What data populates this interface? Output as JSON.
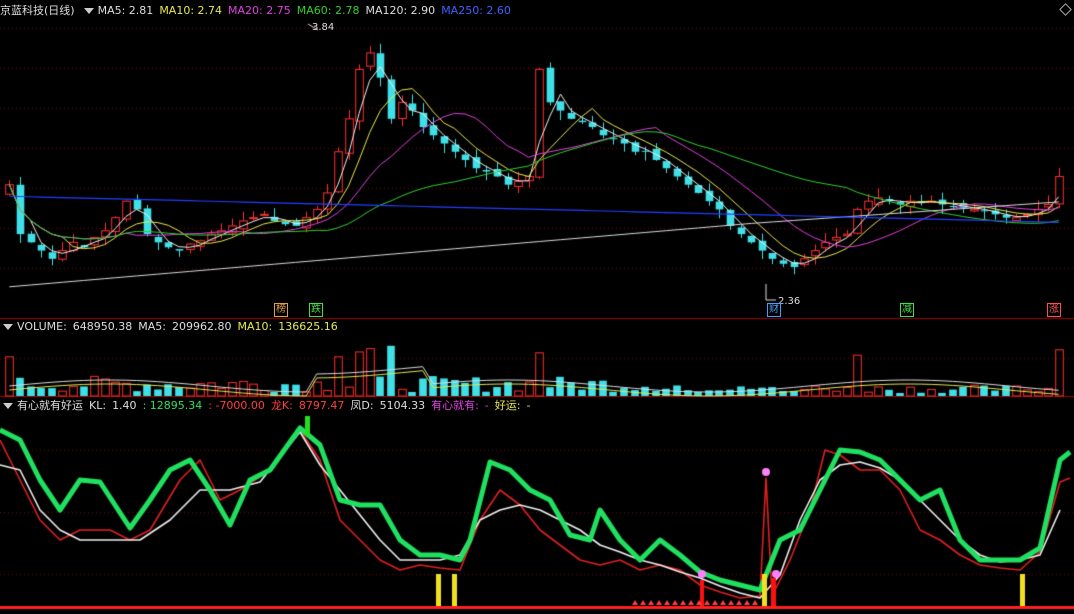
{
  "price_panel": {
    "title": "京蓝科技(日线)",
    "indicators": [
      {
        "name": "MA5",
        "value": "2.81",
        "color": "#dddddd"
      },
      {
        "name": "MA10",
        "value": "2.74",
        "color": "#e8e850"
      },
      {
        "name": "MA20",
        "value": "2.75",
        "color": "#e040e0"
      },
      {
        "name": "MA60",
        "value": "2.78",
        "color": "#30d030"
      },
      {
        "name": "MA120",
        "value": "2.90",
        "color": "#dddddd"
      },
      {
        "name": "MA250",
        "value": "2.60",
        "color": "#4060ff"
      }
    ],
    "high_label": "3.84",
    "low_label": "2.36",
    "event_tags": [
      {
        "text": "榜",
        "color": "#e0a040"
      },
      {
        "text": "跌",
        "color": "#40e040"
      },
      {
        "text": "财",
        "color": "#40a0ff"
      },
      {
        "text": "减",
        "color": "#40e040"
      },
      {
        "text": "涨",
        "color": "#ff5050"
      }
    ]
  },
  "volume_panel": {
    "label": "VOLUME",
    "value": "648950.38",
    "ma5_label": "MA5",
    "ma5_value": "209962.80",
    "ma10_label": "MA10",
    "ma10_value": "136625.16"
  },
  "indicator_panel": {
    "name": "有心就有好运",
    "kl_label": "KL",
    "kl_value": "1.40",
    "v1": "12895.34",
    "v2": "-7000.00",
    "k_label": "龙K",
    "k_value": "8797.47",
    "d_label": "凤D",
    "d_value": "5104.33",
    "t1": "有心就有",
    "t1_value": "-",
    "t2": "好运",
    "t2_value": "-"
  },
  "colors": {
    "up": "#ff3030",
    "down": "#40e0e8",
    "ma250": "#2040ff",
    "green": "#20e060"
  },
  "chart_data": {
    "type": "candlestick",
    "price_range": [
      2.2,
      3.9
    ],
    "candles_close": [
      2.9,
      2.6,
      2.55,
      2.5,
      2.45,
      2.5,
      2.55,
      2.52,
      2.58,
      2.62,
      2.7,
      2.8,
      2.75,
      2.6,
      2.55,
      2.52,
      2.5,
      2.54,
      2.56,
      2.6,
      2.62,
      2.65,
      2.68,
      2.7,
      2.72,
      2.68,
      2.66,
      2.65,
      2.7,
      2.75,
      2.85,
      3.1,
      3.3,
      3.6,
      3.7,
      3.55,
      3.3,
      3.4,
      3.35,
      3.25,
      3.2,
      3.15,
      3.1,
      3.05,
      3.0,
      2.98,
      2.95,
      2.9,
      2.92,
      2.95,
      3.6,
      3.4,
      3.35,
      3.3,
      3.28,
      3.25,
      3.2,
      3.18,
      3.15,
      3.1,
      3.1,
      3.05,
      3.0,
      2.95,
      2.9,
      2.85,
      2.8,
      2.75,
      2.65,
      2.6,
      2.55,
      2.5,
      2.45,
      2.42,
      2.4,
      2.45,
      2.5,
      2.55,
      2.58,
      2.6,
      2.75,
      2.8,
      2.82,
      2.8,
      2.78,
      2.8,
      2.79,
      2.8,
      2.78,
      2.77,
      2.76,
      2.75,
      2.74,
      2.72,
      2.7,
      2.7,
      2.72,
      2.75,
      2.78,
      2.95
    ]
  }
}
